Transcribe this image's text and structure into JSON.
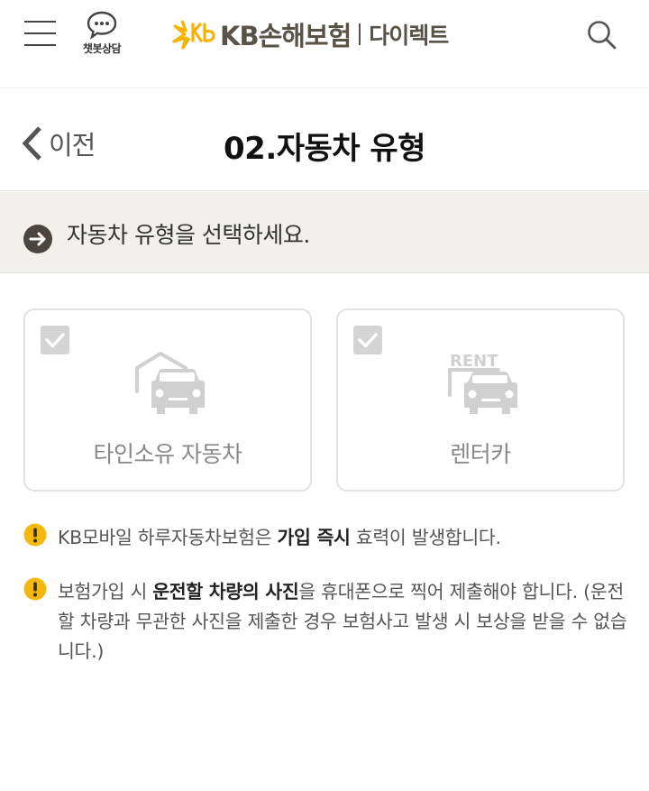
{
  "header": {
    "chatbot_label": "챗봇상담",
    "logo_brand": "KB손해보험",
    "logo_sub": "다이렉트",
    "accent_color": "#f7b100",
    "brand_color": "#5a5147"
  },
  "titlebar": {
    "back_label": "이전",
    "title": "02.자동차 유형"
  },
  "guide": {
    "text": "자동차 유형을 선택하세요."
  },
  "options": [
    {
      "label": "타인소유 자동차",
      "icon": "house-car-icon",
      "checked": false
    },
    {
      "label": "렌터카",
      "icon": "rent-car-icon",
      "checked": false,
      "sign_text": "RENT"
    }
  ],
  "notices": [
    {
      "pre": "KB모바일 하루자동차보험은 ",
      "bold": "가입 즉시",
      "post": " 효력이 발생합니다."
    },
    {
      "pre": "보험가입 시 ",
      "bold": "운전할 차량의 사진",
      "post": "을 휴대폰으로 찍어 제출해야 합니다. (운전할 차량과 무관한 사진을 제출한 경우 보험사고 발생 시 보상을 받을 수 없습니다.)"
    }
  ],
  "colors": {
    "notice_icon": "#f5b80f",
    "guide_bg": "#f2f0ec",
    "option_icon": "#d0d0d0"
  }
}
